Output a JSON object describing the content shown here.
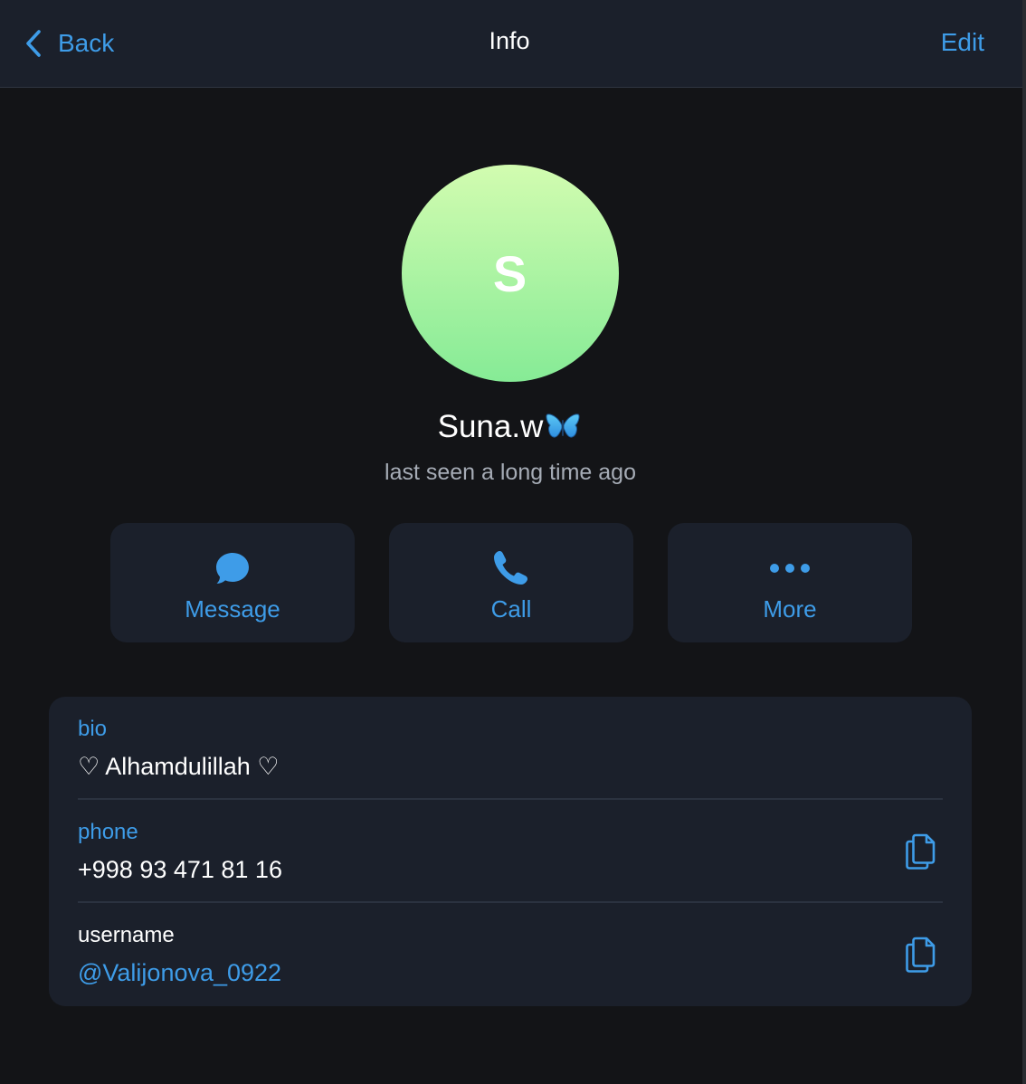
{
  "colors": {
    "accent": "#3e9ce8",
    "header_bg": "#1b202b",
    "page_bg": "#131417",
    "card_bg": "#1b202b",
    "avatar_top": "#d2fcb0",
    "avatar_bottom": "#86eb96",
    "muted_text": "#a6acb6"
  },
  "header": {
    "back_label": "Back",
    "title": "Info",
    "edit_label": "Edit"
  },
  "profile": {
    "avatar_initial": "S",
    "name": "Suna.w",
    "name_emoji_icon": "butterfly-icon",
    "status": "last seen a long time ago"
  },
  "actions": [
    {
      "label": "Message",
      "icon": "message-bubble-icon"
    },
    {
      "label": "Call",
      "icon": "phone-icon"
    },
    {
      "label": "More",
      "icon": "more-dots-icon"
    }
  ],
  "info": {
    "bio": {
      "label": "bio",
      "value": "♡ Alhamdulillah ♡"
    },
    "phone": {
      "label": "phone",
      "value": "+998 93 471 81 16",
      "action_icon": "copy-icon"
    },
    "username": {
      "label": "username",
      "value": "@Valijonova_0922",
      "action_icon": "copy-icon"
    }
  }
}
